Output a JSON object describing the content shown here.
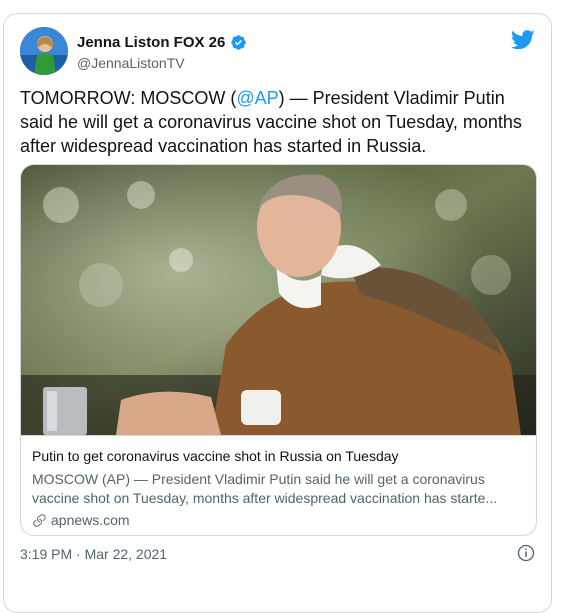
{
  "author": {
    "name": "Jenna Liston FOX 26",
    "handle": "@JennaListonTV"
  },
  "tweet": {
    "text_prefix": "TOMORROW: MOSCOW (",
    "mention": "@AP",
    "text_suffix": ") — President Vladimir Putin said he will get a coronavirus vaccine shot on Tuesday, months after widespread vaccination has started in Russia."
  },
  "link_card": {
    "title": "Putin to get coronavirus vaccine shot in Russia on Tuesday",
    "description": "MOSCOW (AP) — President Vladimir Putin said he will get a coronavirus vaccine shot on Tuesday, months after widespread vaccination has starte...",
    "domain": "apnews.com"
  },
  "timestamp": "3:19 PM · Mar 22, 2021",
  "colors": {
    "accent": "#1d9bf0",
    "text": "#0f1419",
    "muted": "#536471",
    "border": "#cfd9de"
  },
  "icons": [
    "verified-badge-icon",
    "twitter-bird-icon",
    "link-icon",
    "info-icon"
  ]
}
